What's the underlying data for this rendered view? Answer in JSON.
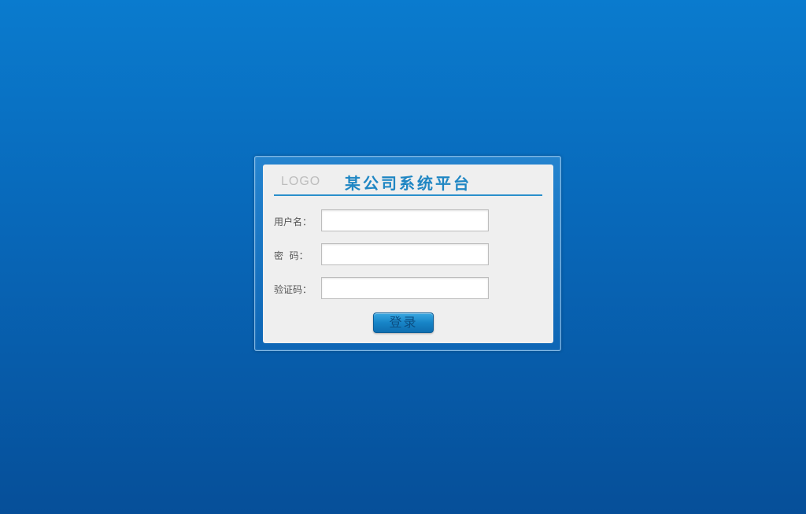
{
  "header": {
    "logo_text": "LOGO",
    "title": "某公司系统平台"
  },
  "form": {
    "username_label": "用户名：",
    "username_value": "",
    "password_label": "密  码：",
    "password_value": "",
    "captcha_label": "验证码：",
    "captcha_value": "",
    "login_button": "登录"
  },
  "colors": {
    "background_top": "#0a7bce",
    "background_bottom": "#064f99",
    "panel": "#efefef",
    "title": "#1f86c3",
    "divider": "#2a8fcb",
    "button": "#1784c7"
  }
}
